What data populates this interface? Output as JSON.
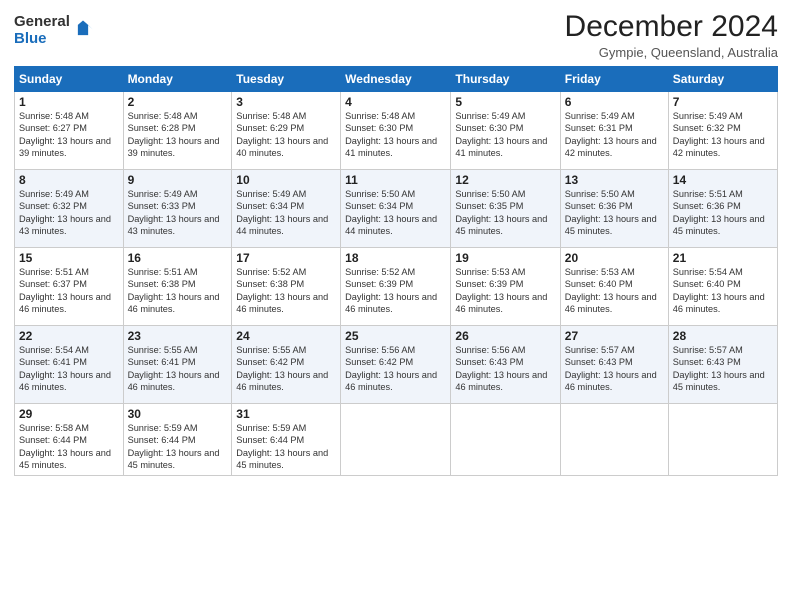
{
  "logo": {
    "general": "General",
    "blue": "Blue"
  },
  "title": "December 2024",
  "subtitle": "Gympie, Queensland, Australia",
  "days_of_week": [
    "Sunday",
    "Monday",
    "Tuesday",
    "Wednesday",
    "Thursday",
    "Friday",
    "Saturday"
  ],
  "weeks": [
    [
      {
        "num": "1",
        "rise": "5:48 AM",
        "set": "6:27 PM",
        "daylight": "13 hours and 39 minutes."
      },
      {
        "num": "2",
        "rise": "5:48 AM",
        "set": "6:28 PM",
        "daylight": "13 hours and 39 minutes."
      },
      {
        "num": "3",
        "rise": "5:48 AM",
        "set": "6:29 PM",
        "daylight": "13 hours and 40 minutes."
      },
      {
        "num": "4",
        "rise": "5:48 AM",
        "set": "6:30 PM",
        "daylight": "13 hours and 41 minutes."
      },
      {
        "num": "5",
        "rise": "5:49 AM",
        "set": "6:30 PM",
        "daylight": "13 hours and 41 minutes."
      },
      {
        "num": "6",
        "rise": "5:49 AM",
        "set": "6:31 PM",
        "daylight": "13 hours and 42 minutes."
      },
      {
        "num": "7",
        "rise": "5:49 AM",
        "set": "6:32 PM",
        "daylight": "13 hours and 42 minutes."
      }
    ],
    [
      {
        "num": "8",
        "rise": "5:49 AM",
        "set": "6:32 PM",
        "daylight": "13 hours and 43 minutes."
      },
      {
        "num": "9",
        "rise": "5:49 AM",
        "set": "6:33 PM",
        "daylight": "13 hours and 43 minutes."
      },
      {
        "num": "10",
        "rise": "5:49 AM",
        "set": "6:34 PM",
        "daylight": "13 hours and 44 minutes."
      },
      {
        "num": "11",
        "rise": "5:50 AM",
        "set": "6:34 PM",
        "daylight": "13 hours and 44 minutes."
      },
      {
        "num": "12",
        "rise": "5:50 AM",
        "set": "6:35 PM",
        "daylight": "13 hours and 45 minutes."
      },
      {
        "num": "13",
        "rise": "5:50 AM",
        "set": "6:36 PM",
        "daylight": "13 hours and 45 minutes."
      },
      {
        "num": "14",
        "rise": "5:51 AM",
        "set": "6:36 PM",
        "daylight": "13 hours and 45 minutes."
      }
    ],
    [
      {
        "num": "15",
        "rise": "5:51 AM",
        "set": "6:37 PM",
        "daylight": "13 hours and 46 minutes."
      },
      {
        "num": "16",
        "rise": "5:51 AM",
        "set": "6:38 PM",
        "daylight": "13 hours and 46 minutes."
      },
      {
        "num": "17",
        "rise": "5:52 AM",
        "set": "6:38 PM",
        "daylight": "13 hours and 46 minutes."
      },
      {
        "num": "18",
        "rise": "5:52 AM",
        "set": "6:39 PM",
        "daylight": "13 hours and 46 minutes."
      },
      {
        "num": "19",
        "rise": "5:53 AM",
        "set": "6:39 PM",
        "daylight": "13 hours and 46 minutes."
      },
      {
        "num": "20",
        "rise": "5:53 AM",
        "set": "6:40 PM",
        "daylight": "13 hours and 46 minutes."
      },
      {
        "num": "21",
        "rise": "5:54 AM",
        "set": "6:40 PM",
        "daylight": "13 hours and 46 minutes."
      }
    ],
    [
      {
        "num": "22",
        "rise": "5:54 AM",
        "set": "6:41 PM",
        "daylight": "13 hours and 46 minutes."
      },
      {
        "num": "23",
        "rise": "5:55 AM",
        "set": "6:41 PM",
        "daylight": "13 hours and 46 minutes."
      },
      {
        "num": "24",
        "rise": "5:55 AM",
        "set": "6:42 PM",
        "daylight": "13 hours and 46 minutes."
      },
      {
        "num": "25",
        "rise": "5:56 AM",
        "set": "6:42 PM",
        "daylight": "13 hours and 46 minutes."
      },
      {
        "num": "26",
        "rise": "5:56 AM",
        "set": "6:43 PM",
        "daylight": "13 hours and 46 minutes."
      },
      {
        "num": "27",
        "rise": "5:57 AM",
        "set": "6:43 PM",
        "daylight": "13 hours and 46 minutes."
      },
      {
        "num": "28",
        "rise": "5:57 AM",
        "set": "6:43 PM",
        "daylight": "13 hours and 45 minutes."
      }
    ],
    [
      {
        "num": "29",
        "rise": "5:58 AM",
        "set": "6:44 PM",
        "daylight": "13 hours and 45 minutes."
      },
      {
        "num": "30",
        "rise": "5:59 AM",
        "set": "6:44 PM",
        "daylight": "13 hours and 45 minutes."
      },
      {
        "num": "31",
        "rise": "5:59 AM",
        "set": "6:44 PM",
        "daylight": "13 hours and 45 minutes."
      },
      null,
      null,
      null,
      null
    ]
  ],
  "labels": {
    "sunrise": "Sunrise:",
    "sunset": "Sunset:",
    "daylight": "Daylight:"
  }
}
